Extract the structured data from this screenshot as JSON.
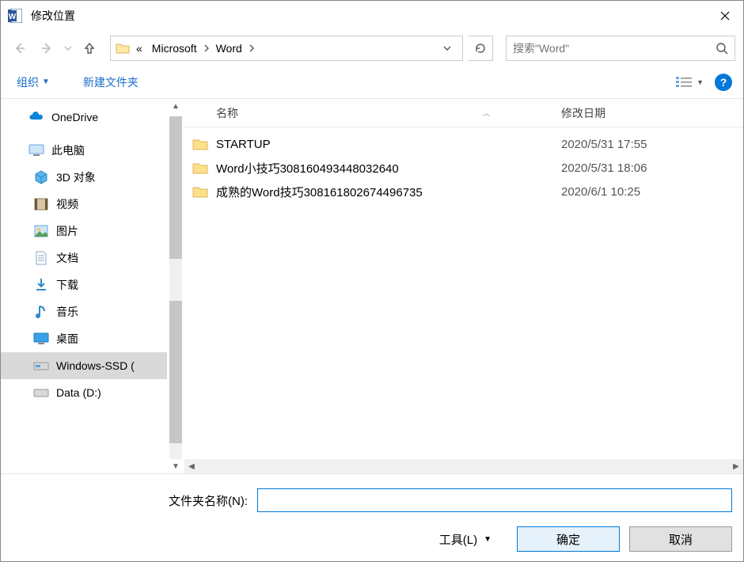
{
  "window": {
    "title": "修改位置"
  },
  "breadcrumb": {
    "ellipsis": "«",
    "items": [
      "Microsoft",
      "Word"
    ]
  },
  "search": {
    "placeholder": "搜索\"Word\""
  },
  "toolbar": {
    "organize": "组织",
    "newfolder": "新建文件夹"
  },
  "tree": {
    "onedrive": "OneDrive",
    "thispc": "此电脑",
    "items": [
      "3D 对象",
      "视频",
      "图片",
      "文档",
      "下载",
      "音乐",
      "桌面",
      "Windows-SSD (",
      "Data (D:)"
    ]
  },
  "columns": {
    "name": "名称",
    "date": "修改日期"
  },
  "rows": [
    {
      "name": "STARTUP",
      "date": "2020/5/31 17:55"
    },
    {
      "name": "Word小技巧308160493448032640",
      "date": "2020/5/31 18:06"
    },
    {
      "name": "成熟的Word技巧308161802674496735",
      "date": "2020/6/1 10:25"
    }
  ],
  "footer": {
    "folder_label": "文件夹名称(N):",
    "folder_value": "",
    "tools": "工具(L)",
    "ok": "确定",
    "cancel": "取消"
  }
}
